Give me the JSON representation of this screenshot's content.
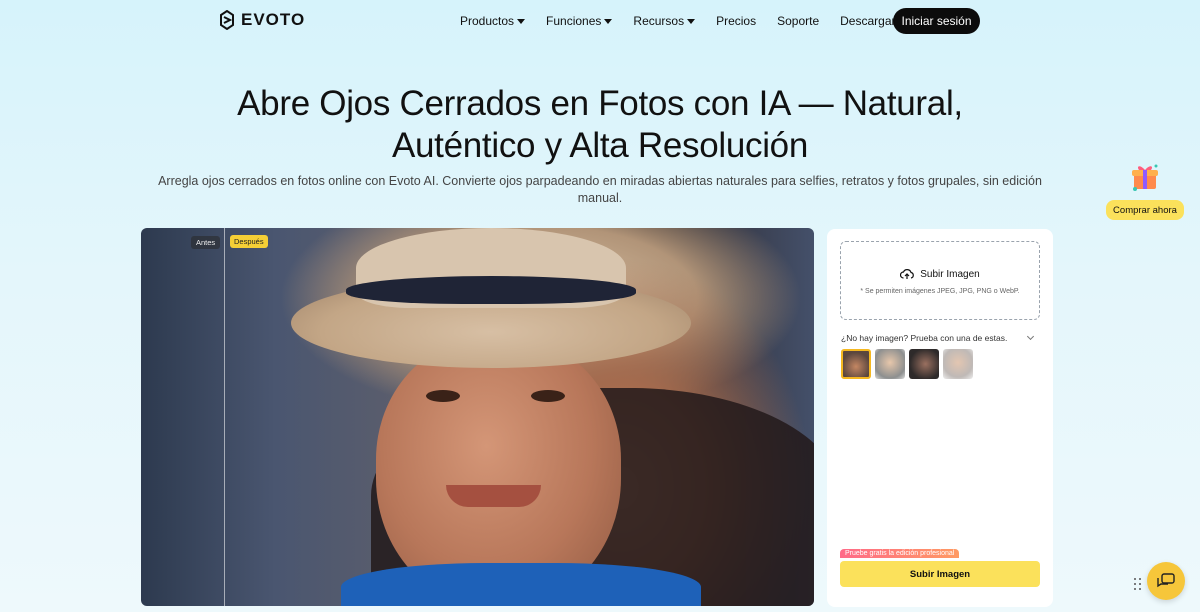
{
  "brand": {
    "logo_text": "EVOTO"
  },
  "nav": {
    "items": [
      {
        "label": "Productos",
        "has_dropdown": true
      },
      {
        "label": "Funciones",
        "has_dropdown": true
      },
      {
        "label": "Recursos",
        "has_dropdown": true
      },
      {
        "label": "Precios",
        "has_dropdown": false
      },
      {
        "label": "Soporte",
        "has_dropdown": false
      },
      {
        "label": "Descargar",
        "has_dropdown": false
      }
    ],
    "login_label": "Iniciar sesión"
  },
  "hero": {
    "title_line1": "Abre Ojos Cerrados en Fotos con IA — Natural,",
    "title_line2": "Auténtico y Alta Resolución",
    "subtitle": "Arregla ojos cerrados en fotos online con Evoto AI. Convierte ojos parpadeando en miradas abiertas naturales para selfies, retratos y fotos grupales, sin edición manual."
  },
  "promo": {
    "label": "Comprar ahora",
    "icon": "gift-box-icon"
  },
  "compare": {
    "before_label": "Antes",
    "after_label": "Después"
  },
  "upload": {
    "title": "Subir Imagen",
    "hint": "* Se permiten imágenes JPEG, JPG, PNG o WebP.",
    "sample_prompt": "¿No hay imagen? Prueba con una de estas.",
    "samples": [
      "sample-1",
      "sample-2",
      "sample-3",
      "sample-4"
    ],
    "pro_badge": "Pruebe gratis la edición profesional",
    "button_label": "Subir Imagen"
  },
  "colors": {
    "accent_yellow": "#fbe15b",
    "dark_button": "#0c0c0c",
    "chat_yellow": "#f6c63a"
  }
}
